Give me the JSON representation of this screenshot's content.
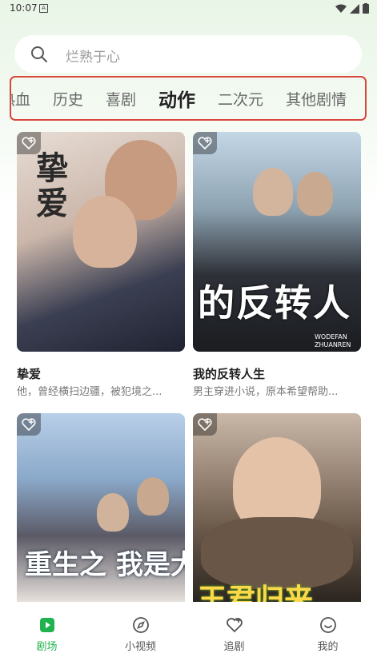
{
  "status": {
    "time": "10:07",
    "a_icon": "A"
  },
  "search": {
    "placeholder": "烂熟于心"
  },
  "tabs": [
    {
      "label": "热血"
    },
    {
      "label": "历史"
    },
    {
      "label": "喜剧"
    },
    {
      "label": "动作",
      "active": true
    },
    {
      "label": "二次元"
    },
    {
      "label": "其他剧情"
    }
  ],
  "cards": [
    {
      "title": "挚爱",
      "desc": "他，曾经横扫边疆，被犯境之...",
      "poster_text": "挚爱"
    },
    {
      "title": "我的反转人生",
      "desc": "男主穿进小说，原本希望帮助...",
      "poster_text": "的反转人",
      "poster_sub": "WODEFAN ZHUANREN"
    },
    {
      "title": "",
      "desc": "",
      "poster_text": "重生之 我是大富豪"
    },
    {
      "title": "",
      "desc": "",
      "poster_text": "王君归来"
    }
  ],
  "nav": [
    {
      "label": "剧场",
      "icon": "theater-icon",
      "active": true
    },
    {
      "label": "小视频",
      "icon": "compass-icon"
    },
    {
      "label": "追剧",
      "icon": "heart-plus-icon"
    },
    {
      "label": "我的",
      "icon": "smile-icon"
    }
  ],
  "colors": {
    "accent": "#20b24e",
    "highlight_frame": "#d9483b"
  }
}
